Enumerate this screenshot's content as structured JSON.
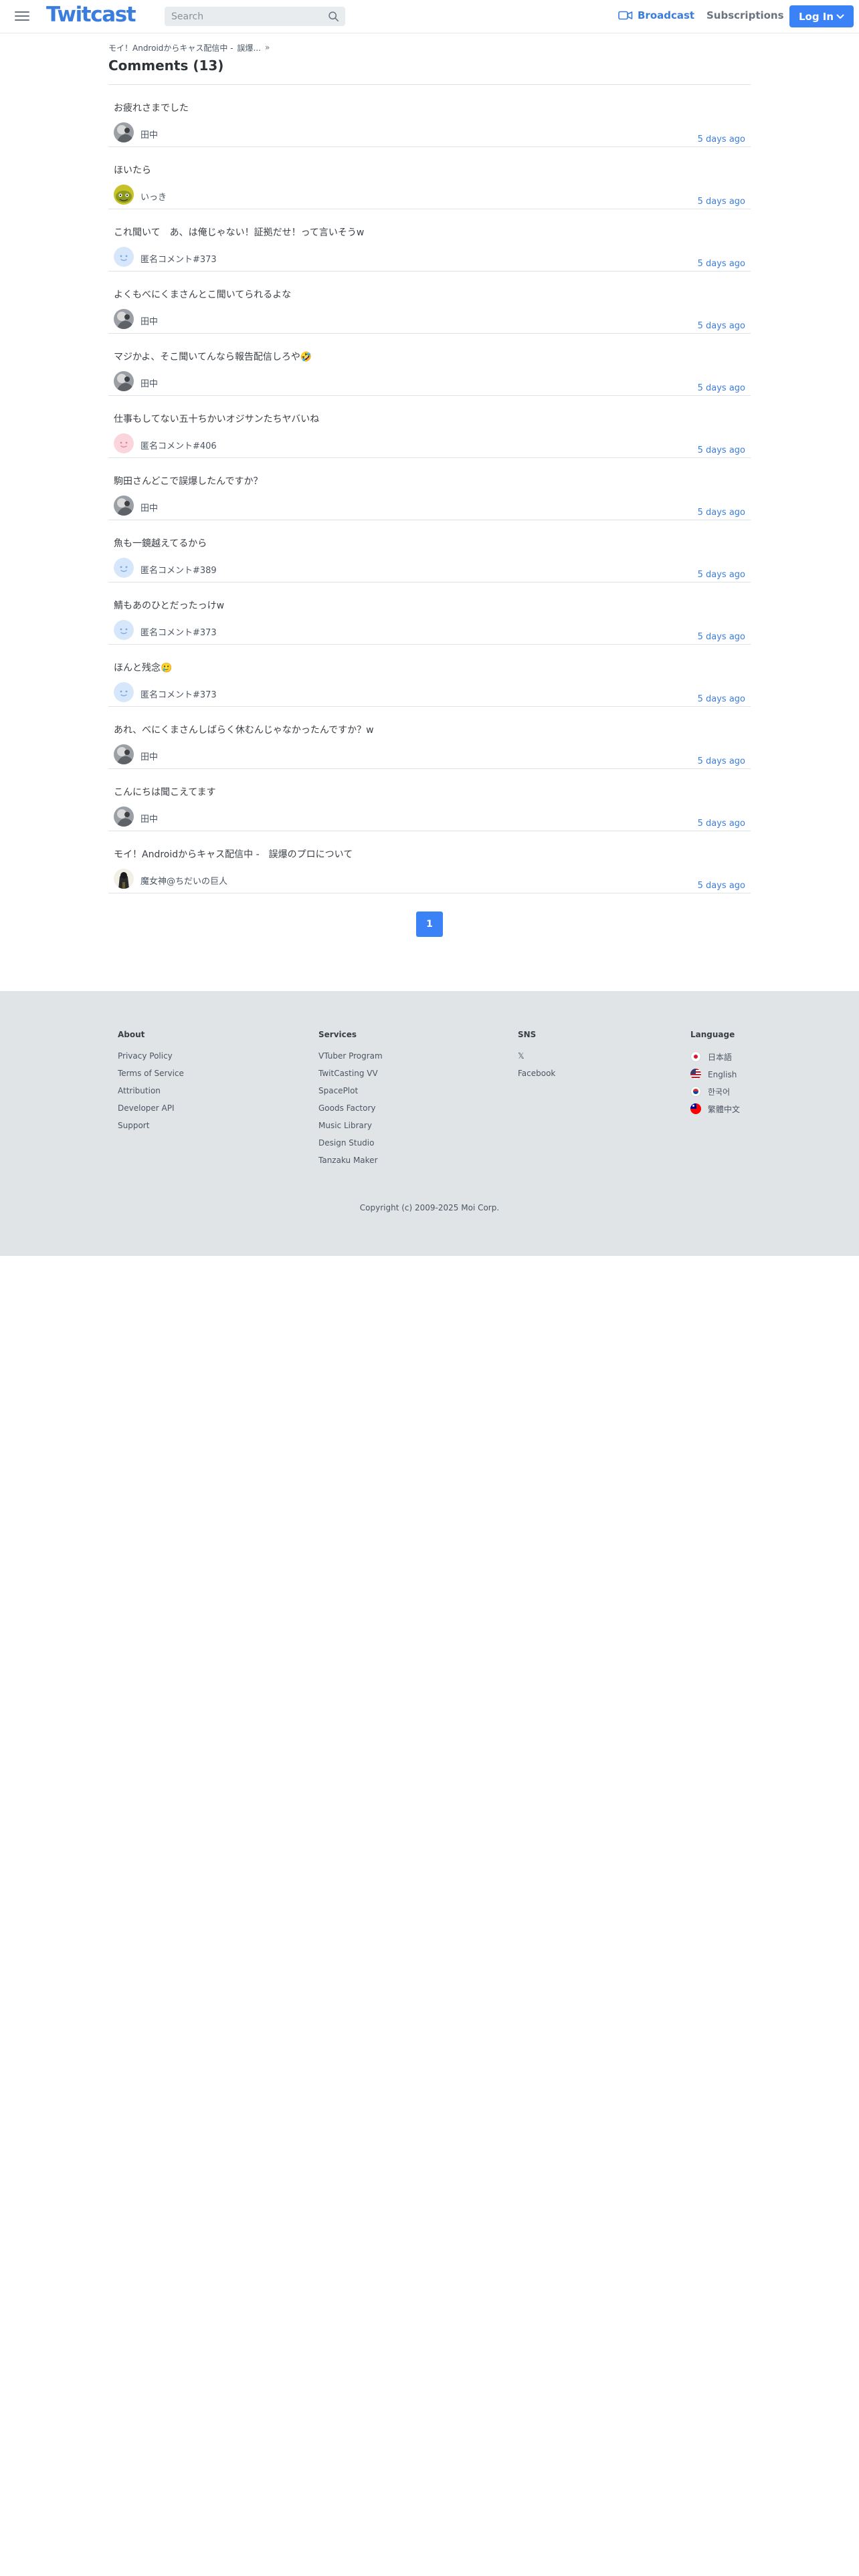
{
  "header": {
    "logo": "Twitcast",
    "search_placeholder": "Search",
    "broadcast": "Broadcast",
    "subscriptions": "Subscriptions",
    "login": "Log In"
  },
  "breadcrumb": [
    "モイ！Androidからキャス配信中 -",
    "誤爆...",
    "»"
  ],
  "page_title": "Comments (13)",
  "comments": [
    {
      "text": "お疲れさまでした",
      "user": "田中",
      "time": "5 days ago",
      "avatar": "photo-avatar"
    },
    {
      "text": "ほいたら",
      "user": "いっき",
      "time": "5 days ago",
      "avatar": "green-avatar"
    },
    {
      "text": "これ聞いて　あ、は俺じゃない！証拠だせ！って言いそうw",
      "user": "匿名コメント#373",
      "time": "5 days ago",
      "avatar": "blue-anon-avatar"
    },
    {
      "text": "よくもべにくまさんとこ聞いてられるよな",
      "user": "田中",
      "time": "5 days ago",
      "avatar": "photo-avatar"
    },
    {
      "text": "マジかよ、そこ聞いてんなら報告配信しろや🤣",
      "user": "田中",
      "time": "5 days ago",
      "avatar": "photo-avatar"
    },
    {
      "text": "仕事もしてない五十ちかいオジサンたちヤバいね",
      "user": "匿名コメント#406",
      "time": "5 days ago",
      "avatar": "pink-anon-avatar"
    },
    {
      "text": "駒田さんどこで誤爆したんですか？",
      "user": "田中",
      "time": "5 days ago",
      "avatar": "photo-avatar"
    },
    {
      "text": "魚も一鏡越えてるから",
      "user": "匿名コメント#389",
      "time": "5 days ago",
      "avatar": "blue-anon-avatar"
    },
    {
      "text": "鯖もあのひとだったっけw",
      "user": "匿名コメント#373",
      "time": "5 days ago",
      "avatar": "blue-anon-avatar"
    },
    {
      "text": "ほんと残念🥲",
      "user": "匿名コメント#373",
      "time": "5 days ago",
      "avatar": "blue-anon-avatar"
    },
    {
      "text": "あれ、べにくまさんしばらく休むんじゃなかったんですか？w",
      "user": "田中",
      "time": "5 days ago",
      "avatar": "photo-avatar"
    },
    {
      "text": "こんにちは聞こえてます",
      "user": "田中",
      "time": "5 days ago",
      "avatar": "photo-avatar"
    },
    {
      "text": "モイ！Androidからキャス配信中 -　誤爆のプロについて",
      "user": "魔女神@ちだいの巨人",
      "time": "5 days ago",
      "avatar": "dark-avatar"
    }
  ],
  "pagination": {
    "current": "1"
  },
  "footer": {
    "about": {
      "title": "About",
      "links": [
        "Privacy Policy",
        "Terms of Service",
        "Attribution",
        "Developer API",
        "Support"
      ]
    },
    "services": {
      "title": "Services",
      "links": [
        "VTuber Program",
        "TwitCasting VV",
        "SpacePlot",
        "Goods Factory",
        "Music Library",
        "Design Studio",
        "Tanzaku Maker"
      ]
    },
    "sns": {
      "title": "SNS",
      "links": [
        "𝕏",
        "Facebook"
      ]
    },
    "language": {
      "title": "Language",
      "links": [
        "日本語",
        "English",
        "한국어",
        "繁體中文"
      ]
    },
    "copyright": "Copyright (c) 2009-2025 Moi Corp."
  },
  "colors": {
    "brand": "#3b7ddd",
    "button": "#3b82f6",
    "footer_bg": "#e1e4e7"
  }
}
